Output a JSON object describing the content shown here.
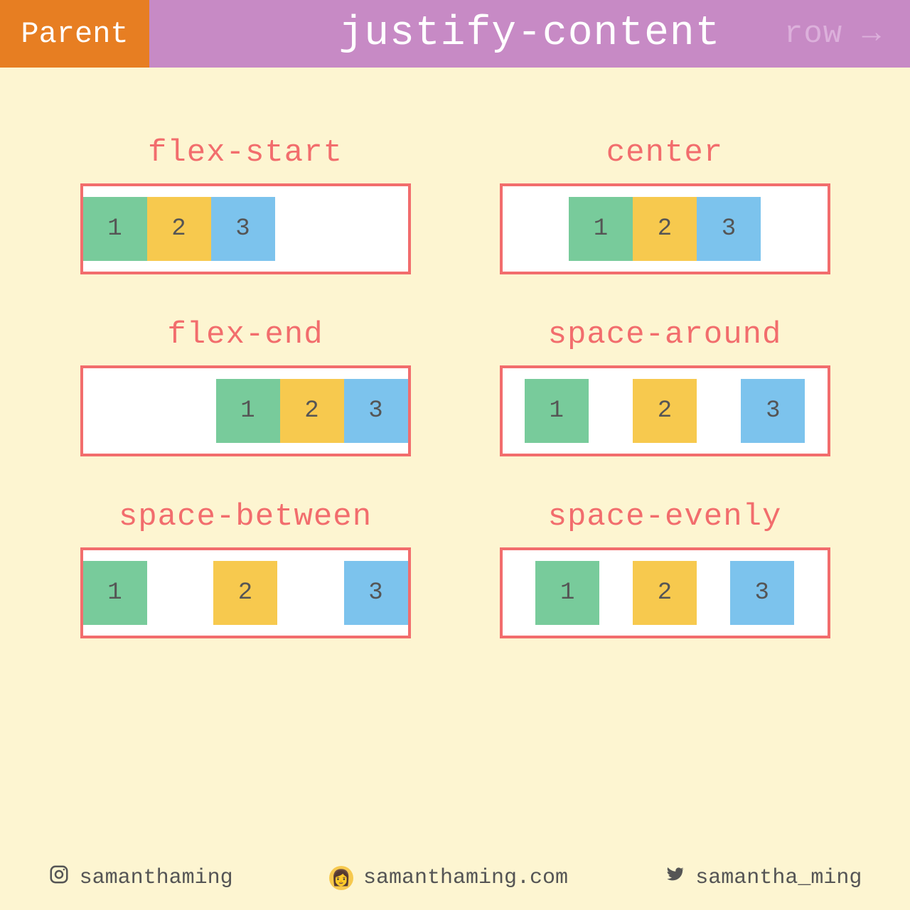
{
  "header": {
    "parent": "Parent",
    "title": "justify-content",
    "direction": "row →"
  },
  "examples": [
    {
      "label": "flex-start",
      "justify": "flex-start",
      "items": [
        "1",
        "2",
        "3"
      ]
    },
    {
      "label": "center",
      "justify": "center",
      "items": [
        "1",
        "2",
        "3"
      ]
    },
    {
      "label": "flex-end",
      "justify": "flex-end",
      "items": [
        "1",
        "2",
        "3"
      ]
    },
    {
      "label": "space-around",
      "justify": "space-around",
      "items": [
        "1",
        "2",
        "3"
      ]
    },
    {
      "label": "space-between",
      "justify": "space-between",
      "items": [
        "1",
        "2",
        "3"
      ]
    },
    {
      "label": "space-evenly",
      "justify": "space-evenly",
      "items": [
        "1",
        "2",
        "3"
      ]
    }
  ],
  "colors": {
    "item1": "#78cb9b",
    "item2": "#f7c94e",
    "item3": "#7cc3ed",
    "border": "#f26d6d",
    "bg": "#fdf5d1",
    "header_orange": "#e77e22",
    "header_purple": "#c78ac5"
  },
  "footer": {
    "instagram": "samanthaming",
    "website": "samanthaming.com",
    "twitter": "samantha_ming"
  }
}
